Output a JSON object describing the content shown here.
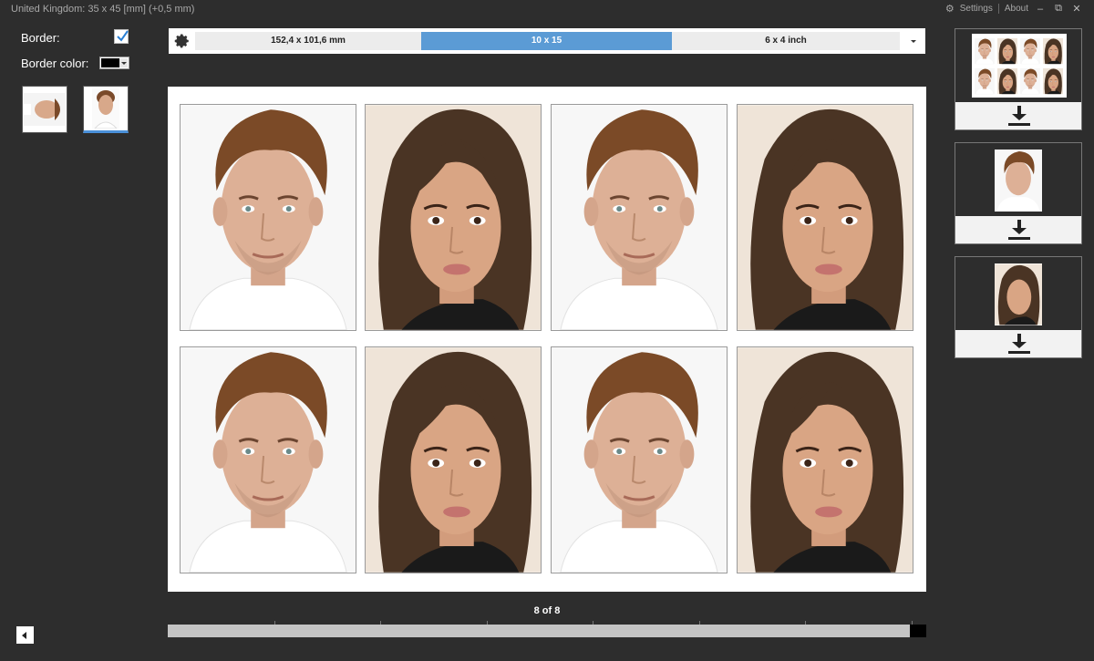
{
  "window": {
    "title": "United Kingdom: 35 x 45 [mm] (+0,5 mm)",
    "settings_label": "Settings",
    "about_label": "About",
    "minimize_glyph": "–",
    "restore_glyph": "⧉",
    "close_glyph": "✕"
  },
  "left_panel": {
    "border_label": "Border:",
    "border_checked": true,
    "border_color_label": "Border color:",
    "border_color": "#000000"
  },
  "size_options": [
    {
      "label": "152,4 x 101,6 mm",
      "active": false
    },
    {
      "label": "10 x 15",
      "active": true
    },
    {
      "label": "6 x 4 inch",
      "active": false
    }
  ],
  "sheet": {
    "photos": [
      "man",
      "woman",
      "man",
      "woman",
      "man",
      "woman",
      "man",
      "woman"
    ]
  },
  "pager": {
    "text": "8 of 8"
  },
  "colors": {
    "accent": "#5b9bd5",
    "background": "#2d2d2d"
  },
  "icons": {
    "settings": "gear-icon",
    "download": "download-icon",
    "back": "triangle-left-icon"
  }
}
